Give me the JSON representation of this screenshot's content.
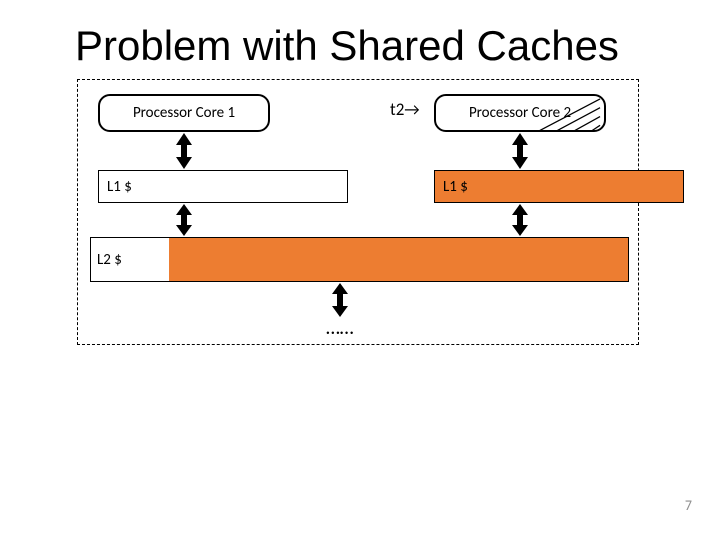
{
  "title": "Problem with Shared Caches",
  "t2": "t2→",
  "core1": "Processor Core 1",
  "core2": "Processor Core 2",
  "l1_left": "L1 $",
  "l1_right": "L1 $",
  "l2": "L2 $",
  "dots": "……",
  "page_number": "7"
}
